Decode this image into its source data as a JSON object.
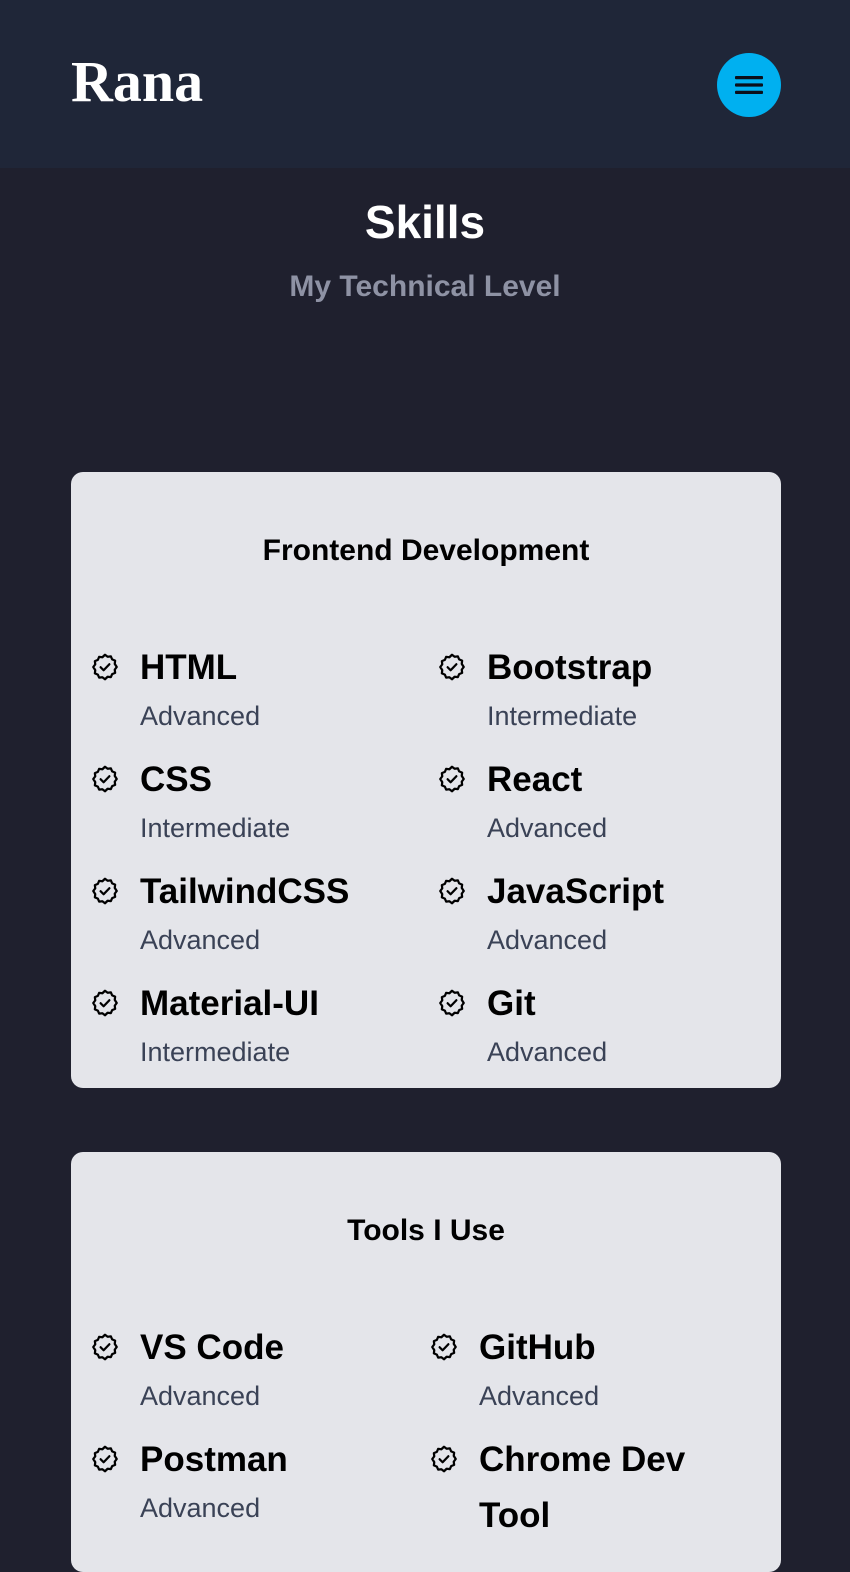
{
  "header": {
    "logo": "Rana"
  },
  "section": {
    "title": "Skills",
    "subtitle": "My Technical Level"
  },
  "frontend": {
    "title": "Frontend Development",
    "skills": [
      {
        "name": "HTML",
        "level": "Advanced"
      },
      {
        "name": "Bootstrap",
        "level": "Intermediate"
      },
      {
        "name": "CSS",
        "level": "Intermediate"
      },
      {
        "name": "React",
        "level": "Advanced"
      },
      {
        "name": "TailwindCSS",
        "level": "Advanced"
      },
      {
        "name": "JavaScript",
        "level": "Advanced"
      },
      {
        "name": "Material-UI",
        "level": "Intermediate"
      },
      {
        "name": "Git",
        "level": "Advanced"
      }
    ]
  },
  "tools": {
    "title": "Tools I Use",
    "skills": [
      {
        "name": "VS Code",
        "level": "Advanced"
      },
      {
        "name": "GitHub",
        "level": "Advanced"
      },
      {
        "name": "Postman",
        "level": "Advanced"
      },
      {
        "name": "Chrome Dev Tool",
        "level": ""
      }
    ]
  },
  "icons": {
    "skill": "badge-check-icon",
    "menu": "hamburger-menu-icon"
  },
  "colors": {
    "header_bg": "#1f2638",
    "page_bg": "#1f202e",
    "accent": "#00b0f0",
    "card_bg": "#e4e5ea"
  }
}
